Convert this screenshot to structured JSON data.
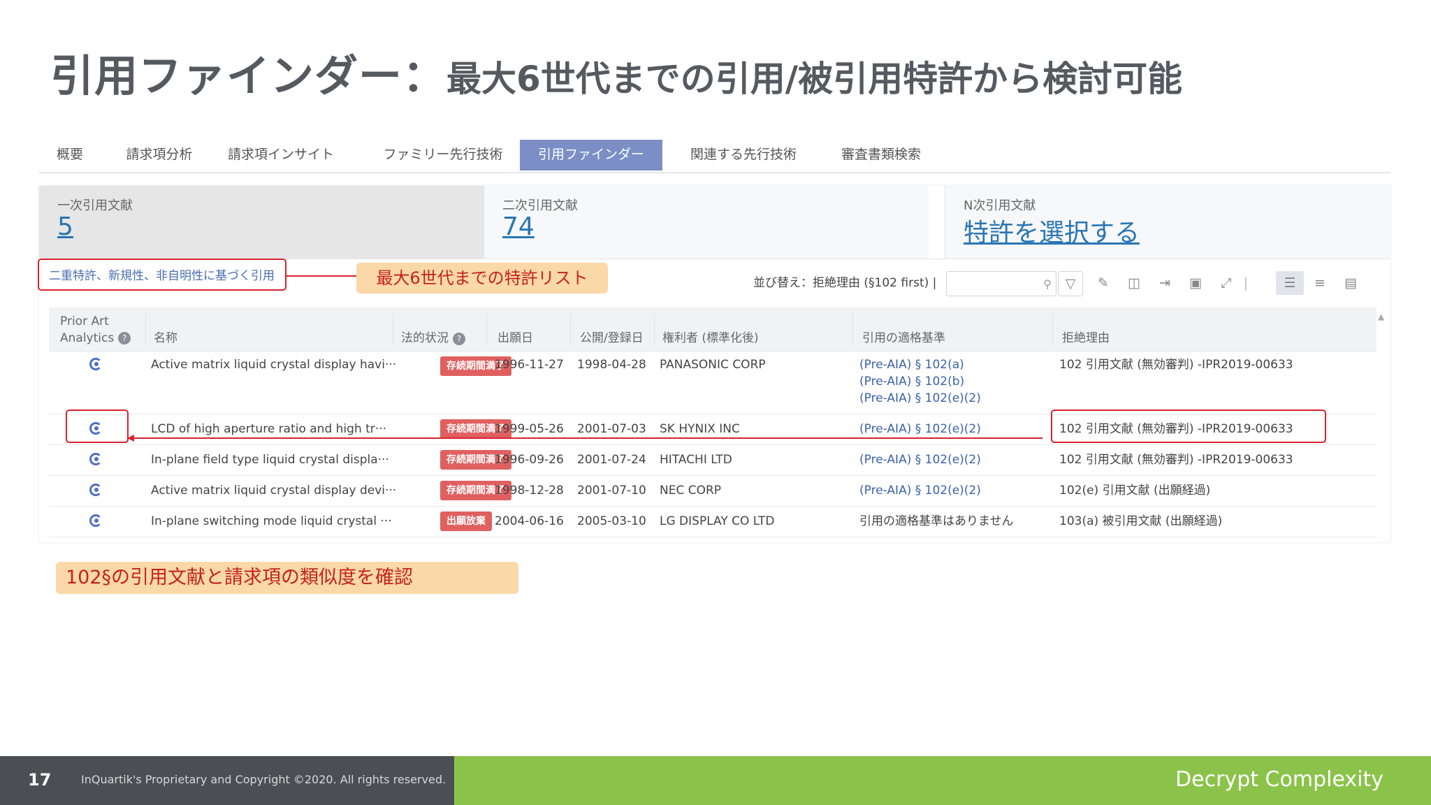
{
  "slide": {
    "title_main": "引用ファインダー：",
    "title_sub": "最大6世代までの引用/被引用特許から検討可能"
  },
  "tabs": [
    {
      "label": "概要"
    },
    {
      "label": "請求項分析"
    },
    {
      "label": "請求項インサイト"
    },
    {
      "label": "ファミリー先行技術"
    },
    {
      "label": "引用ファインダー",
      "active": true
    },
    {
      "label": "関連する先行技術"
    },
    {
      "label": "審査書類検索"
    }
  ],
  "stats": [
    {
      "label": "一次引用文献",
      "value": "5"
    },
    {
      "label": "二次引用文献",
      "value": "74"
    },
    {
      "label": "N次引用文献",
      "value": "特許を選択する"
    }
  ],
  "filter": {
    "label": "二重特許、新規性、非自明性に基づく引用"
  },
  "callout_list": "最大6世代までの特許リスト",
  "sort": {
    "label": "並び替え：拒絶理由 (§102 first) |"
  },
  "search": {
    "placeholder": ""
  },
  "icons": {
    "search": "search-icon",
    "filter": "filter-icon",
    "pencil": "pencil-icon",
    "split": "split-view-icon",
    "export": "export-icon",
    "share": "share-icon",
    "expand": "expand-icon",
    "list_detail": "list-detail-icon",
    "list_compact": "list-compact-icon",
    "list_panel": "list-panel-icon"
  },
  "table": {
    "headers": {
      "prior_art_line1": "Prior Art",
      "prior_art_line2": "Analytics",
      "name": "名称",
      "legal_status": "法的状況",
      "filing_date": "出願日",
      "pub_date": "公開/登録日",
      "assignee": "権利者 (標準化後)",
      "criteria": "引用の適格基準",
      "reason": "拒絶理由"
    },
    "rows": [
      {
        "name": "Active matrix liquid crystal display havi···",
        "status": "存続期間満了",
        "filing": "1996-11-27",
        "pub": "1998-04-28",
        "assignee": "PANASONIC CORP",
        "criteria": [
          "(Pre-AIA) § 102(a)",
          "(Pre-AIA) § 102(b)",
          "(Pre-AIA) § 102(e)(2)"
        ],
        "reason": "102 引用文献 (無効審判) -IPR2019-00633"
      },
      {
        "name": "LCD of high aperture ratio and high tr···",
        "status": "存続期間満了",
        "filing": "1999-05-26",
        "pub": "2001-07-03",
        "assignee": "SK HYNIX INC",
        "criteria": [
          "(Pre-AIA) § 102(e)(2)"
        ],
        "reason": "102 引用文献 (無効審判) -IPR2019-00633"
      },
      {
        "name": "In-plane field type liquid crystal displa···",
        "status": "存続期間満了",
        "filing": "1996-09-26",
        "pub": "2001-07-24",
        "assignee": "HITACHI LTD",
        "criteria": [
          "(Pre-AIA) § 102(e)(2)"
        ],
        "reason": "102 引用文献 (無効審判) -IPR2019-00633"
      },
      {
        "name": "Active matrix liquid crystal display devi···",
        "status": "存続期間満了",
        "filing": "1998-12-28",
        "pub": "2001-07-10",
        "assignee": "NEC CORP",
        "criteria": [
          "(Pre-AIA) § 102(e)(2)"
        ],
        "reason": "102(e) 引用文献 (出願経過)"
      },
      {
        "name": "In-plane switching mode liquid crystal ···",
        "status": "出願放棄",
        "filing": "2004-06-16",
        "pub": "2005-03-10",
        "assignee": "LG DISPLAY CO LTD",
        "criteria": [
          "引用の適格基準はありません"
        ],
        "reason": "103(a) 被引用文献 (出願経過)"
      }
    ]
  },
  "callout_bottom": "102§の引用文献と請求項の類似度を確認",
  "footer": {
    "page_number": "17",
    "copyright": "InQuartik's Proprietary and Copyright ©2020. All rights reserved.",
    "tagline": "Decrypt Complexity"
  },
  "colors": {
    "accent_tab": "#7b8fc6",
    "link_blue": "#2a75b3",
    "highlight_red": "#d8222e",
    "callout_bg": "#fbd8a8",
    "status_red": "#e06060",
    "footer_dark": "#4b4f54",
    "footer_green": "#8bc34a"
  }
}
